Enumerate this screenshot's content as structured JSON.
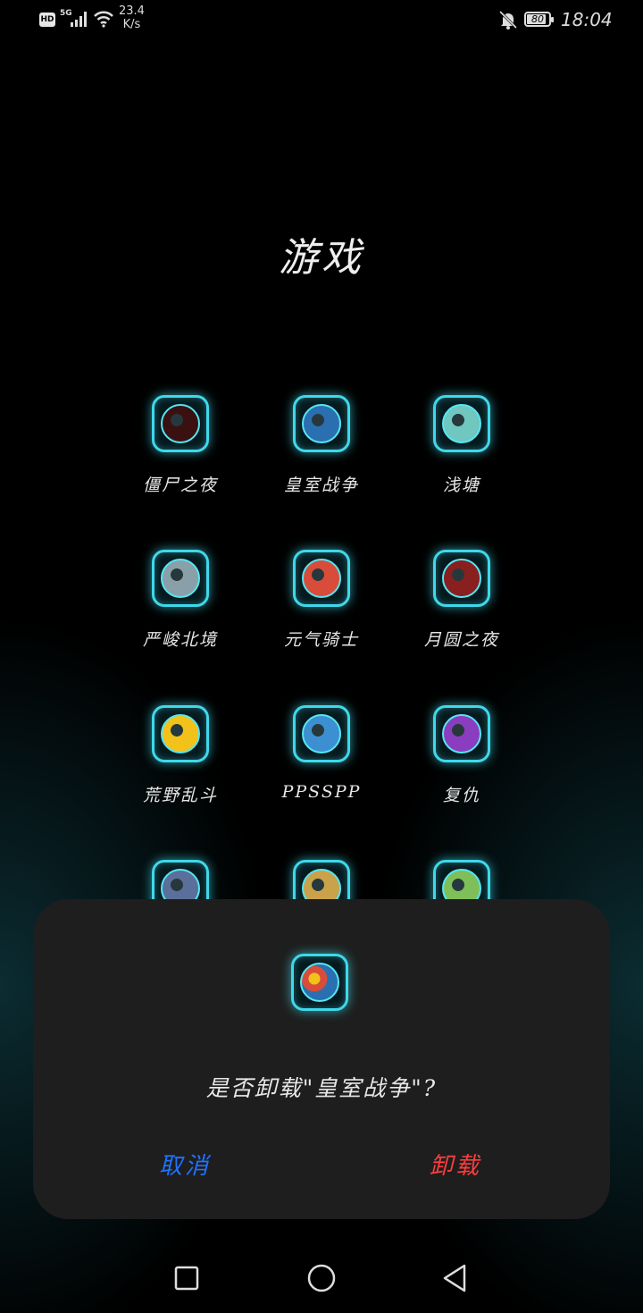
{
  "status_bar": {
    "hd": "HD",
    "network": "5G",
    "speed_value": "23.4",
    "speed_unit": "K/s",
    "battery": "80",
    "time": "18:04"
  },
  "folder": {
    "title": "游戏",
    "apps": [
      {
        "label": "僵尸之夜",
        "icon": "zombie-hand-icon",
        "color": "#3a1010"
      },
      {
        "label": "皇室战争",
        "icon": "clash-royale-icon",
        "color": "#2a6fb0"
      },
      {
        "label": "浅塘",
        "icon": "pond-icon",
        "color": "#6fc7c0"
      },
      {
        "label": "严峻北境",
        "icon": "knight-helmet-icon",
        "color": "#8aa0a8"
      },
      {
        "label": "元气骑士",
        "icon": "soul-knight-icon",
        "color": "#d94c3a"
      },
      {
        "label": "月圆之夜",
        "icon": "full-moon-spiral-icon",
        "color": "#8a1f1f"
      },
      {
        "label": "荒野乱斗",
        "icon": "brawl-stars-skull-icon",
        "color": "#f2c21a"
      },
      {
        "label": "PPSSPP",
        "icon": "ppsspp-icon",
        "color": "#3c8fd0"
      },
      {
        "label": "复仇",
        "icon": "revenge-hero-icon",
        "color": "#8a3dbf"
      },
      {
        "label": "",
        "icon": "dragon-icon",
        "color": "#5a6f9a"
      },
      {
        "label": "",
        "icon": "sudoku-icon",
        "color": "#c9a24a"
      },
      {
        "label": "",
        "icon": "panda-icon",
        "color": "#7fbf5a"
      }
    ]
  },
  "dialog": {
    "message": "是否卸载\"皇室战争\"?",
    "cancel_label": "取消",
    "uninstall_label": "卸载",
    "app_icon": "clash-royale-icon"
  },
  "colors": {
    "accent_glow": "#3fd8ea",
    "cancel": "#1f73ff",
    "uninstall": "#ff3d3d",
    "dialog_bg": "#1e1e1e"
  }
}
